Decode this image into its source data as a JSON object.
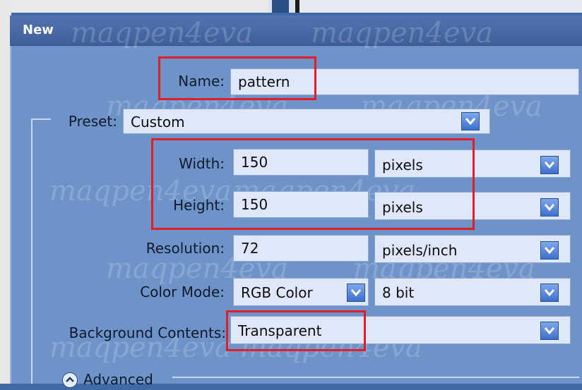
{
  "dialog": {
    "title": "New"
  },
  "name": {
    "label": "Name:",
    "value": "pattern"
  },
  "preset": {
    "label": "Preset:",
    "value": "Custom"
  },
  "width": {
    "label": "Width:",
    "value": "150",
    "unit": "pixels"
  },
  "height": {
    "label": "Height:",
    "value": "150",
    "unit": "pixels"
  },
  "resolution": {
    "label": "Resolution:",
    "value": "72",
    "unit": "pixels/inch"
  },
  "color_mode": {
    "label": "Color Mode:",
    "value": "RGB Color",
    "depth": "8 bit"
  },
  "background": {
    "label": "Background Contents:",
    "value": "Transparent"
  },
  "advanced": {
    "label": "Advanced"
  },
  "watermark": "maqpen4eva",
  "colors": {
    "dialog_bg": "#6d93c8",
    "field_bg": "#dfe8fb",
    "highlight": "#e11f28",
    "title_bar": "#3e5f9a"
  }
}
